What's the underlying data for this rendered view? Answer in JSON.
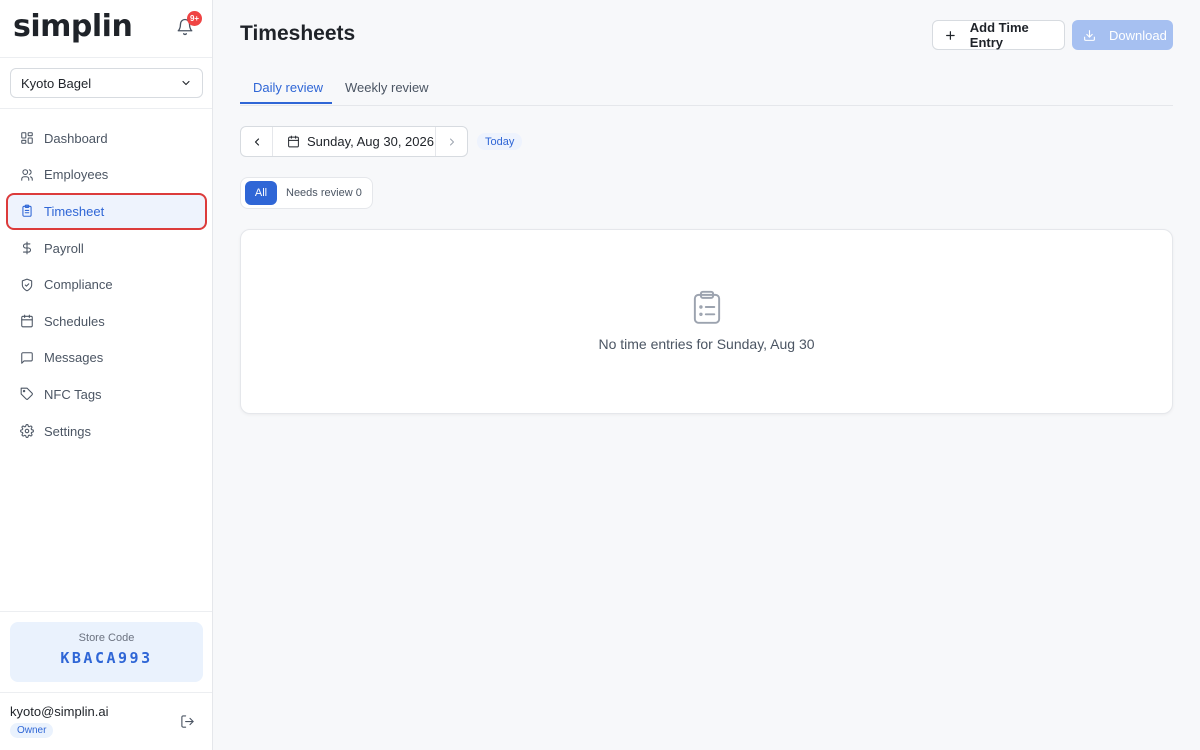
{
  "app": {
    "logo": "simplin",
    "notification_badge": "9+"
  },
  "store_select": {
    "value": "Kyoto Bagel"
  },
  "sidebar": {
    "items": [
      {
        "label": "Dashboard",
        "icon": "dashboard-icon"
      },
      {
        "label": "Employees",
        "icon": "users-icon"
      },
      {
        "label": "Timesheet",
        "icon": "clipboard-icon",
        "active": true
      },
      {
        "label": "Payroll",
        "icon": "dollar-icon"
      },
      {
        "label": "Compliance",
        "icon": "shield-icon"
      },
      {
        "label": "Schedules",
        "icon": "calendar-icon"
      },
      {
        "label": "Messages",
        "icon": "message-icon"
      },
      {
        "label": "NFC Tags",
        "icon": "tag-icon"
      },
      {
        "label": "Settings",
        "icon": "gear-icon"
      }
    ]
  },
  "store_code": {
    "label": "Store Code",
    "value": "KBACA993"
  },
  "user": {
    "email": "kyoto@simplin.ai",
    "role": "Owner"
  },
  "header": {
    "title": "Timesheets",
    "add_label": "Add Time Entry",
    "download_label": "Download"
  },
  "tabs": [
    {
      "label": "Daily review",
      "active": true
    },
    {
      "label": "Weekly review",
      "active": false
    }
  ],
  "date_nav": {
    "date": "Sunday, Aug 30, 2026",
    "today_label": "Today"
  },
  "filter": {
    "all_label": "All",
    "needs_review_label": "Needs review 0"
  },
  "empty_state": {
    "message": "No time entries for Sunday, Aug 30"
  },
  "colors": {
    "accent": "#2f66d6",
    "active_outline": "#dc3b3b",
    "badge": "#ef4444",
    "download_disabled": "#a6c0f1"
  }
}
